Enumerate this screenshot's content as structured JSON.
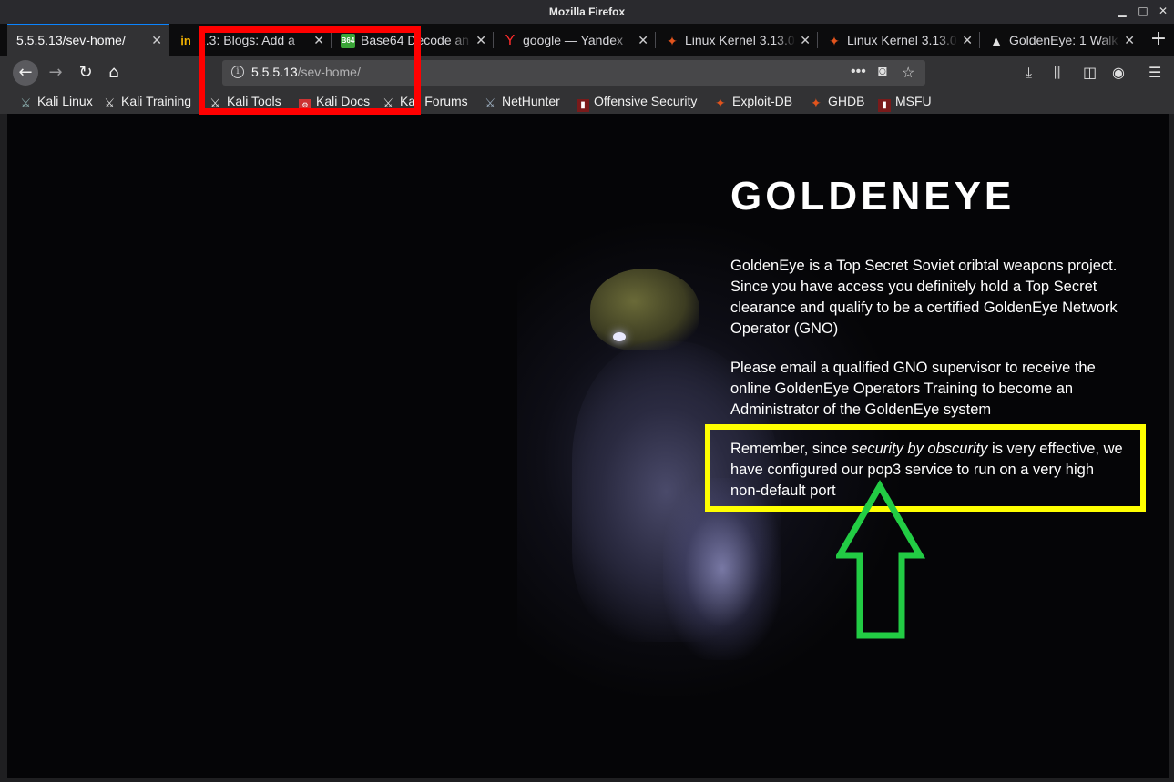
{
  "window": {
    "title": "Mozilla Firefox"
  },
  "tabs": [
    {
      "label": "5.5.5.13/sev-home/",
      "active": true
    },
    {
      "label": "2.3: Blogs: Add a"
    },
    {
      "label": "Base64 Decode an"
    },
    {
      "label": "google — Yandex"
    },
    {
      "label": "Linux Kernel 3.13.0"
    },
    {
      "label": "Linux Kernel 3.13.0"
    },
    {
      "label": "GoldenEye: 1 Walk"
    }
  ],
  "url": {
    "host": "5.5.5.13",
    "path": "/sev-home/"
  },
  "bookmarks": [
    {
      "label": "Kali Linux"
    },
    {
      "label": "Kali Training"
    },
    {
      "label": "Kali Tools"
    },
    {
      "label": "Kali Docs"
    },
    {
      "label": "Kali Forums"
    },
    {
      "label": "NetHunter"
    },
    {
      "label": "Offensive Security"
    },
    {
      "label": "Exploit-DB"
    },
    {
      "label": "GHDB"
    },
    {
      "label": "MSFU"
    }
  ],
  "content": {
    "heading": "GOLDENEYE",
    "para1": "GoldenEye is a Top Secret Soviet oribtal weapons project. Since you have access you definitely hold a Top Secret clearance and qualify to be a certified GoldenEye Network Operator (GNO)",
    "para2": "Please email a qualified GNO supervisor to receive the online GoldenEye Operators Training to become an Administrator of the GoldenEye system",
    "para3_before": "Remember, since ",
    "para3_em": "security by obscurity",
    "para3_after": " is very effective, we have configured our pop3 service to run on a very high non-default port"
  },
  "colors": {
    "annotation_url": "#ff0000",
    "annotation_text": "#ffff00",
    "annotation_arrow": "#22cc44"
  }
}
